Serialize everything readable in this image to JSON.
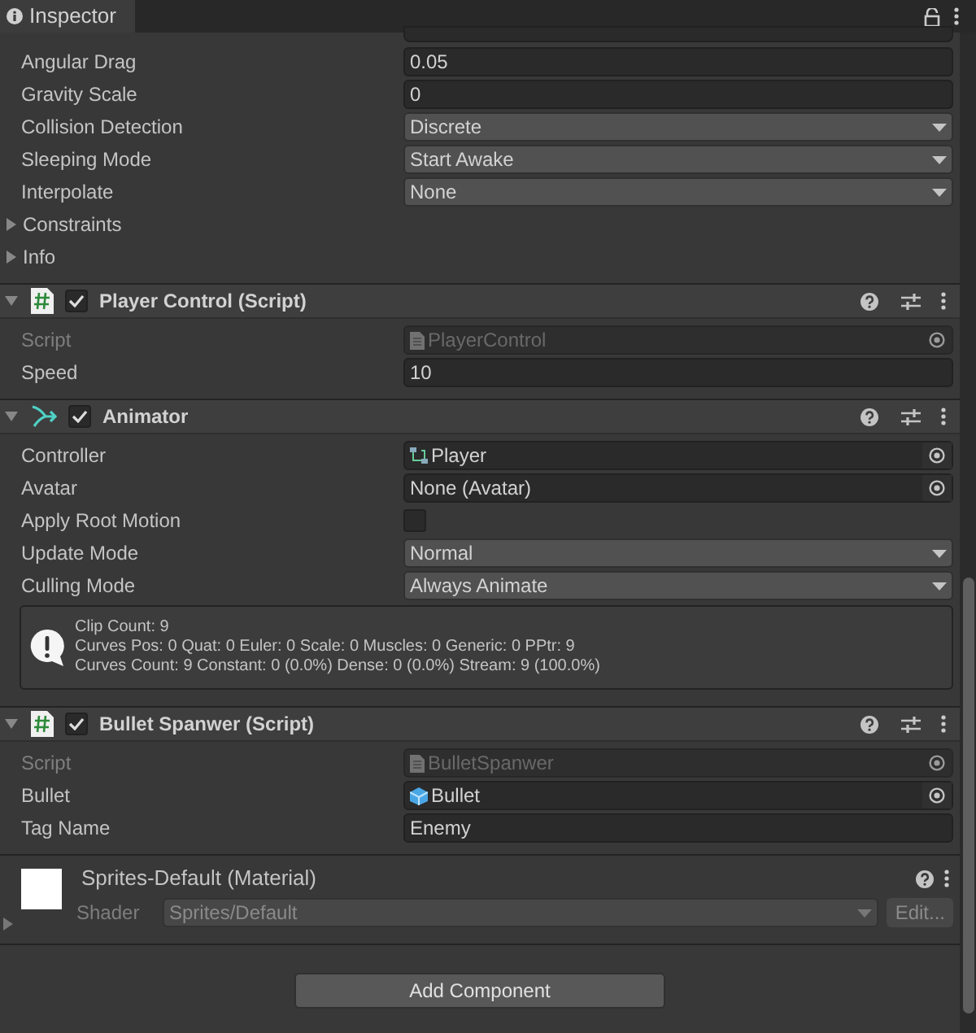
{
  "tab": {
    "title": "Inspector",
    "selected": true
  },
  "rigidbody": {
    "rows": [
      {
        "label": "Angular Drag",
        "kind": "text",
        "value": "0.05"
      },
      {
        "label": "Gravity Scale",
        "kind": "text",
        "value": "0"
      },
      {
        "label": "Collision Detection",
        "kind": "dropdown",
        "value": "Discrete"
      },
      {
        "label": "Sleeping Mode",
        "kind": "dropdown",
        "value": "Start Awake"
      },
      {
        "label": "Interpolate",
        "kind": "dropdown",
        "value": "None"
      },
      {
        "label": "Constraints",
        "kind": "foldout",
        "expanded": false
      },
      {
        "label": "Info",
        "kind": "foldout",
        "expanded": false
      }
    ]
  },
  "components": [
    {
      "title": "Player Control (Script)",
      "kind": "script",
      "enabled": true,
      "expanded": true,
      "rows": [
        {
          "label": "Script",
          "kind": "script_object",
          "value": "PlayerControl",
          "disabled": true
        },
        {
          "label": "Speed",
          "kind": "text",
          "value": "10"
        }
      ]
    },
    {
      "title": "Animator",
      "kind": "animator",
      "enabled": true,
      "expanded": true,
      "rows": [
        {
          "label": "Controller",
          "kind": "controller_object",
          "value": "Player"
        },
        {
          "label": "Avatar",
          "kind": "object",
          "value": "None (Avatar)"
        },
        {
          "label": "Apply Root Motion",
          "kind": "checkbox",
          "checked": false
        },
        {
          "label": "Update Mode",
          "kind": "dropdown",
          "value": "Normal"
        },
        {
          "label": "Culling Mode",
          "kind": "dropdown",
          "value": "Always Animate"
        }
      ],
      "info": [
        "Clip Count: 9",
        "Curves Pos: 0 Quat: 0 Euler: 0 Scale: 0 Muscles: 0 Generic: 0 PPtr: 9",
        "Curves Count: 9 Constant: 0 (0.0%) Dense: 0 (0.0%) Stream: 9 (100.0%)"
      ]
    },
    {
      "title": "Bullet Spanwer (Script)",
      "kind": "script",
      "enabled": true,
      "expanded": true,
      "rows": [
        {
          "label": "Script",
          "kind": "script_object",
          "value": "BulletSpanwer",
          "disabled": true
        },
        {
          "label": "Bullet",
          "kind": "prefab_object",
          "value": "Bullet"
        },
        {
          "label": "Tag Name",
          "kind": "text",
          "value": "Enemy"
        }
      ]
    }
  ],
  "material": {
    "name": "Sprites-Default (Material)",
    "shader_label": "Shader",
    "shader": "Sprites/Default",
    "edit_button": "Edit...",
    "expanded": false
  },
  "add_component": "Add Component"
}
